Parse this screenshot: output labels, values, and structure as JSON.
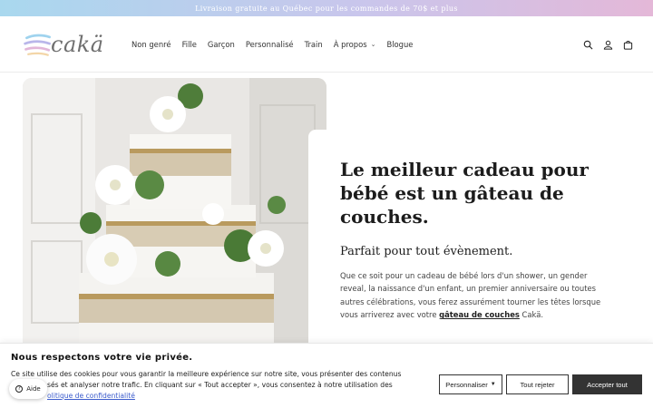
{
  "announcement": {
    "text": "Livraison gratuite au Québec pour les commandes de 70$ et plus"
  },
  "logo": {
    "text": "cakä"
  },
  "nav": {
    "items": [
      {
        "label": "Non genré"
      },
      {
        "label": "Fille"
      },
      {
        "label": "Garçon"
      },
      {
        "label": "Personnalisé"
      },
      {
        "label": "Train"
      },
      {
        "label": "À propos"
      },
      {
        "label": "Blogue"
      }
    ]
  },
  "header_icons": [
    "search-icon",
    "account-icon",
    "cart-icon"
  ],
  "hero": {
    "title": "Le meilleur cadeau pour bébé est un gâteau de couches.",
    "subtitle": "Parfait pour tout évènement.",
    "paragraph_pre": "Que ce soit pour un cadeau de bébé lors d'un shower, un gender reveal, la naissance d'un enfant, un premier anniversaire ou toutes autres célébrations, vous ferez assurément tourner les têtes lorsque vous arriverez avec votre ",
    "paragraph_link": "gâteau de couches",
    "paragraph_post": " Cakä.",
    "image_alt": "Gâteau de couches décoré de fleurs blanches et de dentelle"
  },
  "cookie": {
    "title": "Nous respectons votre vie privée.",
    "text_line1": "Ce site utilise des cookies pour vous garantir la meilleure expérience sur notre site, vous présenter des contenus",
    "text_line2": "sés et analyser notre trafic. En cliquant sur « Tout accepter », vous consentez à notre utilisation des",
    "link": "olitique de confidentialité",
    "personalize": "Personnaliser",
    "reject": "Tout rejeter",
    "accept": "Accepter tout"
  },
  "help": {
    "label": "Aide"
  },
  "colors": {
    "announce_start": "#a9d8ee",
    "announce_end": "#e4b8d8",
    "accept_bg": "#333333",
    "link": "#3b5bcc"
  }
}
